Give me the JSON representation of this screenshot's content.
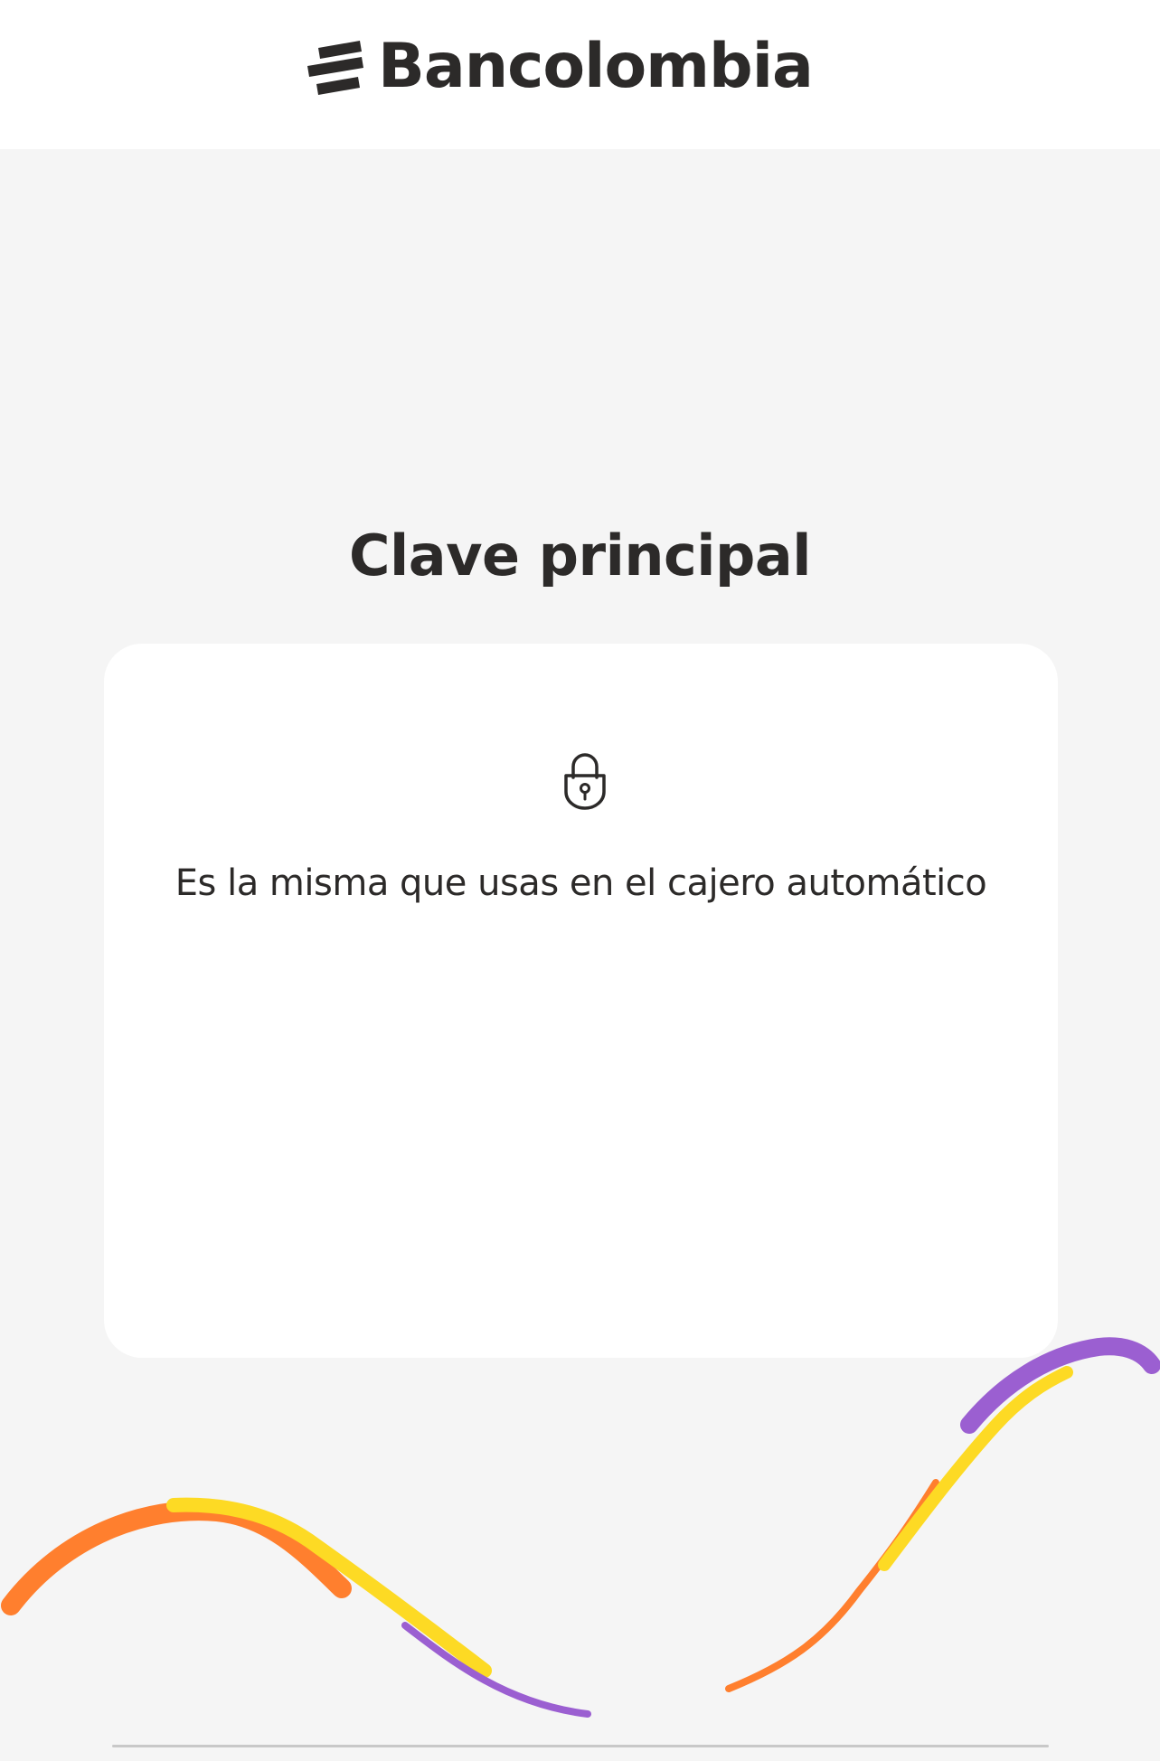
{
  "header": {
    "brand_name": "Bancolombia"
  },
  "main": {
    "title": "Clave principal",
    "card": {
      "icon": "lock-icon",
      "description": "Es la misma que usas en el cajero automático"
    }
  },
  "colors": {
    "background": "#f5f5f5",
    "text": "#2c2a29",
    "card": "#ffffff",
    "wave_orange": "#ff7f2e",
    "wave_yellow": "#fdda24",
    "wave_purple": "#9b5fd1"
  }
}
